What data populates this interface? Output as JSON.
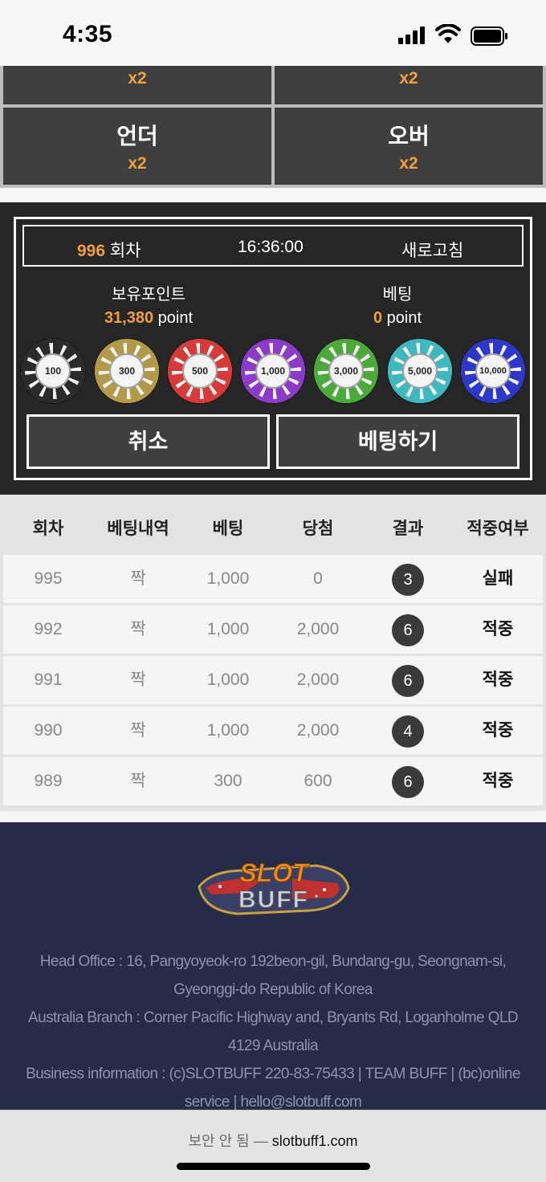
{
  "status_bar": {
    "time": "4:35"
  },
  "bet_options": [
    {
      "label": "",
      "odds": "x2"
    },
    {
      "label": "",
      "odds": "x2"
    },
    {
      "label": "언더",
      "odds": "x2"
    },
    {
      "label": "오버",
      "odds": "x2"
    }
  ],
  "round_info": {
    "round_number": "996",
    "round_suffix": "회차",
    "time": "16:36:00",
    "refresh_label": "새로고침"
  },
  "points": {
    "holding_label": "보유포인트",
    "holding_value": "31,380",
    "holding_unit": " point",
    "bet_label": "베팅",
    "bet_value": "0",
    "bet_unit": " point"
  },
  "chips": [
    {
      "value": "100",
      "color": "#2b2b2b"
    },
    {
      "value": "300",
      "color": "#b39a4a"
    },
    {
      "value": "500",
      "color": "#d83a3a"
    },
    {
      "value": "1,000",
      "color": "#8c3bc8"
    },
    {
      "value": "3,000",
      "color": "#4caa3a"
    },
    {
      "value": "5,000",
      "color": "#3fb8c0"
    },
    {
      "value": "10,000",
      "color": "#2e38c8"
    }
  ],
  "buttons": {
    "cancel": "취소",
    "place_bet": "베팅하기"
  },
  "history": {
    "headers": [
      "회차",
      "베팅내역",
      "베팅",
      "당첨",
      "결과",
      "적중여부"
    ],
    "rows": [
      {
        "round": "995",
        "choice": "짝",
        "bet": "1,000",
        "win": "0",
        "result": "3",
        "status": "실패"
      },
      {
        "round": "992",
        "choice": "짝",
        "bet": "1,000",
        "win": "2,000",
        "result": "6",
        "status": "적중"
      },
      {
        "round": "991",
        "choice": "짝",
        "bet": "1,000",
        "win": "2,000",
        "result": "6",
        "status": "적중"
      },
      {
        "round": "990",
        "choice": "짝",
        "bet": "1,000",
        "win": "2,000",
        "result": "4",
        "status": "적중"
      },
      {
        "round": "989",
        "choice": "짝",
        "bet": "300",
        "win": "600",
        "result": "6",
        "status": "적중"
      }
    ]
  },
  "footer": {
    "logo_top": "SLOT",
    "logo_bottom": "BUFF",
    "lines": [
      "Head Office : 16, Pangyoyeok-ro 192beon-gil, Bundang-gu, Seongnam-si,",
      "Gyeonggi-do Republic of Korea",
      "Australia Branch : Corner Pacific Highway and, Bryants Rd, Loganholme QLD",
      "4129 Australia",
      "Business information : (c)SLOTBUFF 220-83-75433 | TEAM BUFF | (bc)online",
      "service | hello@slotbuff.com"
    ]
  },
  "browser": {
    "security_label": "보안 안 됨 — ",
    "url": "slotbuff1.com"
  }
}
